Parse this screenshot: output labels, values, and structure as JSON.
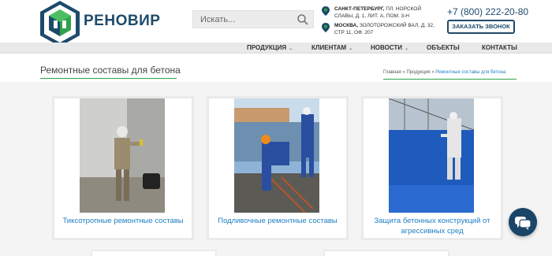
{
  "header": {
    "brand": "РЕНОВИР",
    "search_placeholder": "Искать...",
    "addresses": [
      {
        "city": "САНКТ-ПЕТЕРБУРГ,",
        "line1": " ПЛ. НОРСКОЙ",
        "line2": "СЛАВЫ, Д. 1, ЛИТ. А, ПОМ. 3-Н"
      },
      {
        "city": "МОСКВА,",
        "line1": " ЗОЛОТОРОЖСКИЙ ВАЛ, Д. 32,",
        "line2": "СТР 11, ОФ. 207"
      }
    ],
    "phone": "+7 (800) 222-20-80",
    "call_button": "ЗАКАЗАТЬ ЗВОНОК"
  },
  "nav": {
    "items": [
      {
        "label": "ПРОДУКЦИЯ",
        "has_dropdown": true
      },
      {
        "label": "КЛИЕНТАМ",
        "has_dropdown": true
      },
      {
        "label": "НОВОСТИ",
        "has_dropdown": true
      },
      {
        "label": "ОБЪЕКТЫ",
        "has_dropdown": false
      },
      {
        "label": "КОНТАКТЫ",
        "has_dropdown": false
      }
    ]
  },
  "page": {
    "title": "Ремонтные составы для бетона",
    "breadcrumb": [
      "Главная",
      "Продукция",
      "Ремонтные составы для бетона"
    ],
    "breadcrumb_sep": "»"
  },
  "cards": [
    {
      "caption": "Тиксотропные ремонтные составы"
    },
    {
      "caption": "Подливочные ремонтные составы"
    },
    {
      "caption": "Защита бетонных конструкций от агрессивных сред"
    }
  ],
  "colors": {
    "brand": "#1e4a6b",
    "accent_green": "#2fa24a",
    "link": "#1e7fc4"
  },
  "icons": {
    "search": "search-icon",
    "pin": "map-pin-icon",
    "chat": "chat-icon"
  }
}
